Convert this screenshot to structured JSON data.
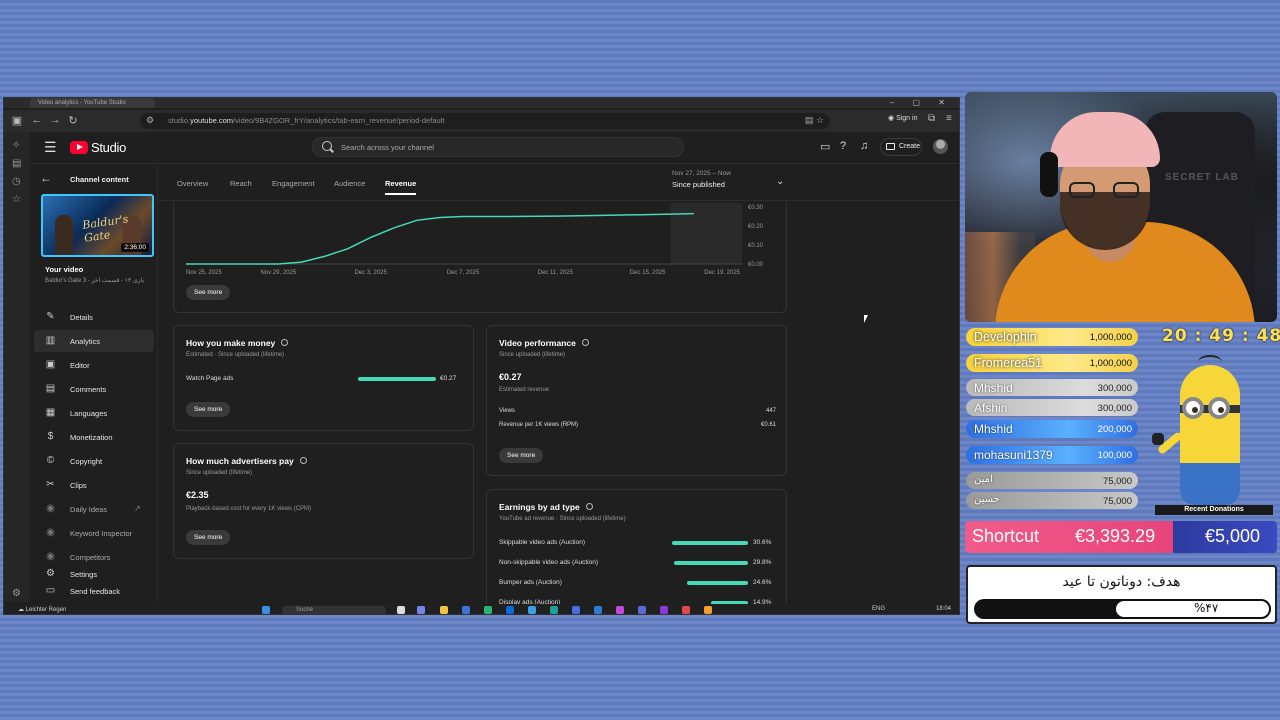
{
  "browser": {
    "tab_title": "Video analytics - YouTube Studio",
    "url_prefix": "studio.",
    "url_domain": "youtube.com",
    "url_path": "/video/9B4ZGOR_frY/analytics/tab-earn_revenue/period-default",
    "signin_label": "Sign in",
    "window_controls": "–  ▢  ✕"
  },
  "studio": {
    "logo_text": "Studio",
    "search_placeholder": "Search across your channel",
    "create_label": "Create"
  },
  "leftnav": {
    "back_label": "Channel content",
    "thumbnail_duration": "2:36:00",
    "thumbnail_text": "Baldur's Gate",
    "your_video_label": "Your video",
    "video_title": "Baldur's Gate 3 - بازی ۱۳ - قسمت آخر",
    "items": [
      {
        "label": "Details",
        "icon": "pencil-icon"
      },
      {
        "label": "Analytics",
        "icon": "analytics-icon"
      },
      {
        "label": "Editor",
        "icon": "editor-icon"
      },
      {
        "label": "Comments",
        "icon": "comments-icon"
      },
      {
        "label": "Languages",
        "icon": "languages-icon"
      },
      {
        "label": "Monetization",
        "icon": "monetization-icon"
      },
      {
        "label": "Copyright",
        "icon": "copyright-icon"
      },
      {
        "label": "Clips",
        "icon": "scissors-icon"
      },
      {
        "label": "Daily Ideas",
        "icon": "ideas-icon"
      },
      {
        "label": "Keyword Inspector",
        "icon": "keyword-icon"
      },
      {
        "label": "Competitors",
        "icon": "competitors-icon"
      },
      {
        "label": "Settings",
        "icon": "gear-icon"
      },
      {
        "label": "Send feedback",
        "icon": "feedback-icon"
      }
    ]
  },
  "tabs": {
    "items": [
      "Overview",
      "Reach",
      "Engagement",
      "Audience",
      "Revenue"
    ],
    "active": "Revenue",
    "date_range_top": "Nov 27, 2025 – Now",
    "date_range_main": "Since published"
  },
  "revenue_chart": {
    "see_more": "See more"
  },
  "chart_data": {
    "type": "line",
    "title": "",
    "x": [
      "Nov 25, 2025",
      "Nov 29, 2025",
      "Dec 3, 2025",
      "Dec 7, 2025",
      "Dec 11, 2025",
      "Dec 15, 2025",
      "Dec 19, 2025"
    ],
    "y_ticks": [
      "€0.00",
      "€0.10",
      "€0.20",
      "€0.30"
    ],
    "ylim": [
      0,
      0.3
    ],
    "series": [
      {
        "x": [
          "2025-11-25",
          "2025-11-28",
          "2025-11-29",
          "2025-11-30",
          "2025-12-01",
          "2025-12-02",
          "2025-12-03",
          "2025-12-04",
          "2025-12-05",
          "2025-12-06",
          "2025-12-07",
          "2025-12-09",
          "2025-12-11",
          "2025-12-13",
          "2025-12-15",
          "2025-12-17"
        ],
        "values": [
          0.0,
          0.0,
          0.0,
          0.01,
          0.04,
          0.08,
          0.14,
          0.19,
          0.23,
          0.245,
          0.25,
          0.25,
          0.252,
          0.256,
          0.26,
          0.265
        ]
      }
    ],
    "grid": false,
    "shaded_region_start": "2025-12-16"
  },
  "money_card": {
    "title": "How you make money",
    "subtitle": "Estimated · Since uploaded (lifetime)",
    "row_label": "Watch Page ads",
    "row_value": "€0.27",
    "row_fraction": 1.0,
    "see_more": "See more"
  },
  "advertisers_card": {
    "title": "How much advertisers pay",
    "subtitle": "Since uploaded (lifetime)",
    "value": "€2.35",
    "value_label": "Playback-based cost for every 1K views (CPM)",
    "see_more": "See more"
  },
  "performance_card": {
    "title": "Video performance",
    "subtitle": "Since uploaded (lifetime)",
    "value": "€0.27",
    "value_label": "Estimated revenue",
    "rows": [
      {
        "label": "Views",
        "value": "447"
      },
      {
        "label": "Revenue per 1K views (RPM)",
        "value": "€0.61"
      }
    ],
    "see_more": "See more"
  },
  "adtype_card": {
    "title": "Earnings by ad type",
    "subtitle": "YouTube ad revenue · Since uploaded (lifetime)",
    "rows": [
      {
        "label": "Skippable video ads (Auction)",
        "value": "30.6%",
        "pct": 30.6
      },
      {
        "label": "Non-skippable video ads (Auction)",
        "value": "29.8%",
        "pct": 29.8
      },
      {
        "label": "Bumper ads (Auction)",
        "value": "24.6%",
        "pct": 24.6
      },
      {
        "label": "Display ads (Auction)",
        "value": "14.9%",
        "pct": 14.9
      }
    ]
  },
  "taskbar": {
    "weather": "Leichter Regen",
    "search": "Suche",
    "lang": "ENG",
    "time": "18:04"
  },
  "overlay": {
    "chair_text": "SECRET LAB",
    "clock": "20 : 49 : 48",
    "donors": [
      {
        "name": "Develophin",
        "amount": "1,000,000"
      },
      {
        "name": "Fromerea51",
        "amount": "1,000,000"
      },
      {
        "name": "Mhshid",
        "amount": "300,000"
      },
      {
        "name": "Afshin",
        "amount": "300,000"
      },
      {
        "name": "Mhshid",
        "amount": "200,000"
      },
      {
        "name": "mohasuni1379",
        "amount": "100,000"
      },
      {
        "name": "امین",
        "amount": "75,000"
      },
      {
        "name": "حسین",
        "amount": "75,000"
      }
    ],
    "minion_label": "Recent Donations",
    "shortcut_label": "Shortcut",
    "shortcut_amount": "€3,393.29",
    "shortcut_goal": "€5,000",
    "goal_text": "هدف: دوناتون تا عید",
    "goal_percent_text": "%۴۷",
    "goal_fraction": 0.47
  }
}
